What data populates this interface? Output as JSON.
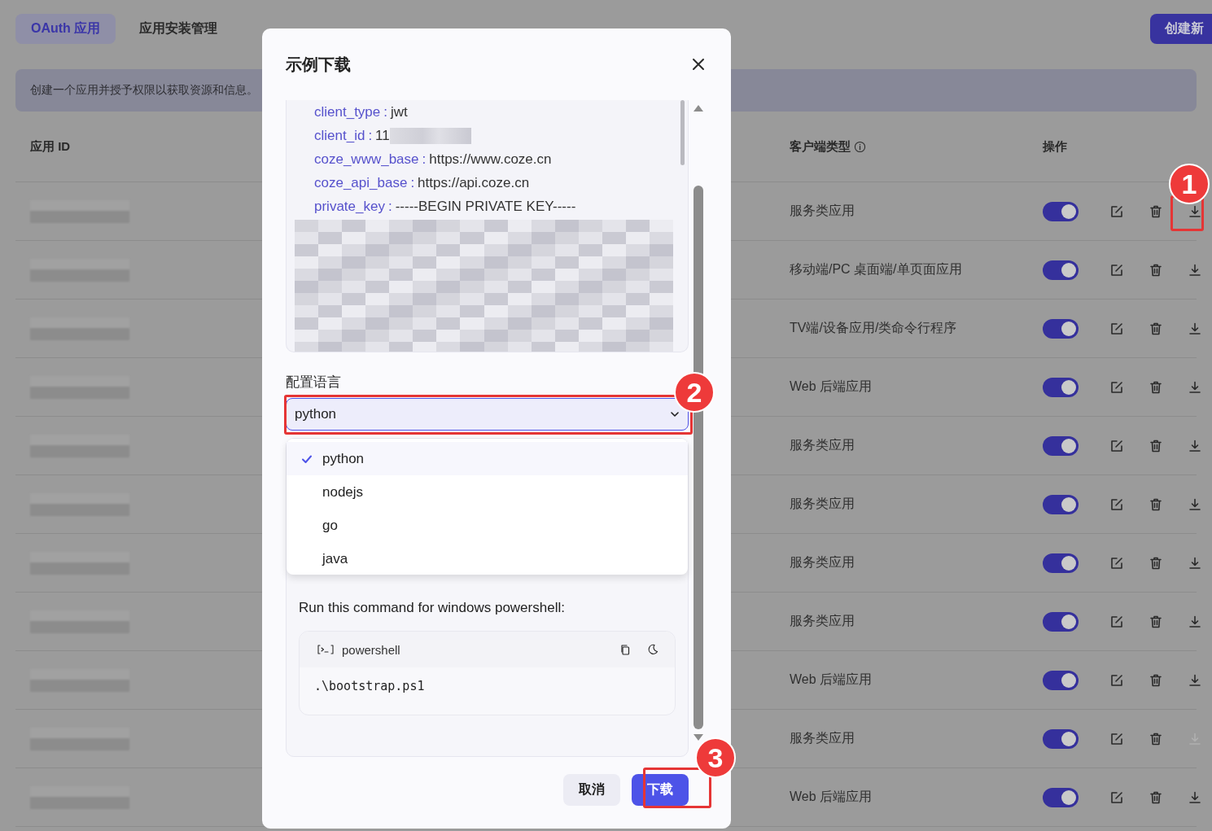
{
  "tabs": [
    {
      "label": "OAuth 应用",
      "selected": true
    },
    {
      "label": "应用安装管理",
      "selected": false
    }
  ],
  "create_button": "创建新",
  "banner": "创建一个应用并授予权限以获取资源和信息。",
  "table": {
    "columns": [
      {
        "label": "应用 ID",
        "info": false
      },
      {
        "label": "客户端类型",
        "info": true
      },
      {
        "label": "操作",
        "info": false
      }
    ],
    "rows": [
      {
        "client_type": "服务类应用",
        "enabled": true,
        "download_disabled": false
      },
      {
        "client_type": "移动端/PC 桌面端/单页面应用",
        "enabled": true,
        "download_disabled": false
      },
      {
        "client_type": "TV端/设备应用/类命令行程序",
        "enabled": true,
        "download_disabled": false
      },
      {
        "client_type": "Web 后端应用",
        "enabled": true,
        "download_disabled": false
      },
      {
        "client_type": "服务类应用",
        "enabled": true,
        "download_disabled": false
      },
      {
        "client_type": "服务类应用",
        "enabled": true,
        "download_disabled": false
      },
      {
        "client_type": "服务类应用",
        "enabled": true,
        "download_disabled": false
      },
      {
        "client_type": "服务类应用",
        "enabled": true,
        "download_disabled": false
      },
      {
        "client_type": "Web 后端应用",
        "enabled": true,
        "download_disabled": false
      },
      {
        "client_type": "服务类应用",
        "enabled": true,
        "download_disabled": true
      },
      {
        "client_type": "Web 后端应用",
        "enabled": true,
        "download_disabled": false
      }
    ]
  },
  "dialog": {
    "title": "示例下载",
    "config": [
      {
        "key": "client_type",
        "separator": ":",
        "value": "jwt",
        "redacted": false
      },
      {
        "key": "client_id",
        "separator": ":",
        "value": "11",
        "redacted": true
      },
      {
        "key": "coze_www_base",
        "separator": ":",
        "value": "https://www.coze.cn",
        "redacted": false
      },
      {
        "key": "coze_api_base",
        "separator": ":",
        "value": "https://api.coze.cn",
        "redacted": false
      },
      {
        "key": "private_key",
        "separator": ":",
        "value": "-----BEGIN PRIVATE KEY-----",
        "redacted": false
      }
    ],
    "language_label": "配置语言",
    "language_select": {
      "value": "python",
      "expanded": true,
      "options": [
        {
          "label": "python",
          "selected": true
        },
        {
          "label": "nodejs",
          "selected": false
        },
        {
          "label": "go",
          "selected": false
        },
        {
          "label": "java",
          "selected": false
        }
      ]
    },
    "instruction": "Run this command for windows powershell:",
    "code": {
      "language": "powershell",
      "text": ".\\bootstrap.ps1"
    },
    "buttons": [
      {
        "label": "取消",
        "kind": "secondary"
      },
      {
        "label": "下载",
        "kind": "primary"
      }
    ]
  },
  "annotations": [
    {
      "number": "1"
    },
    {
      "number": "2"
    },
    {
      "number": "3"
    }
  ]
}
